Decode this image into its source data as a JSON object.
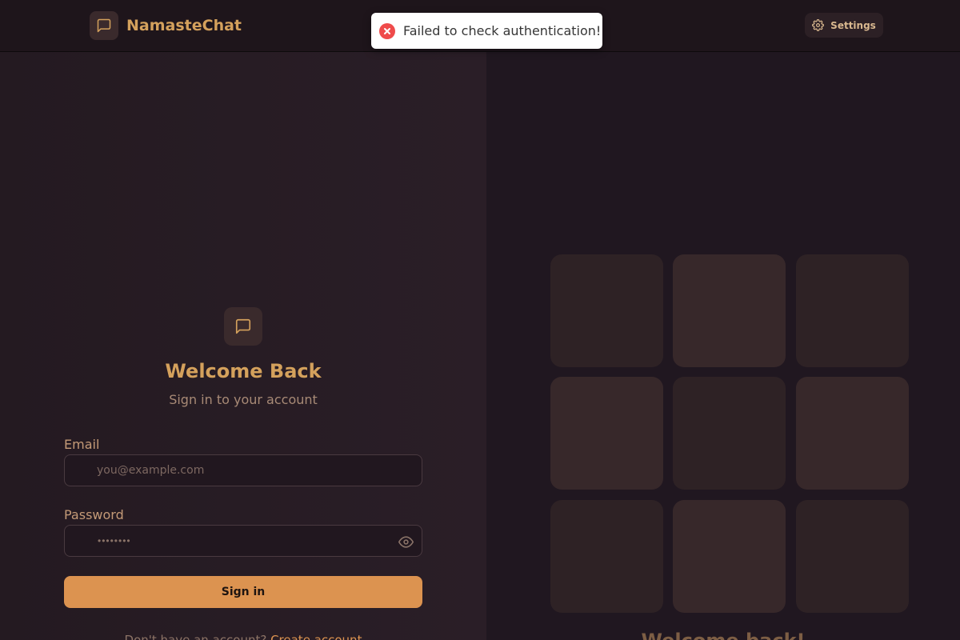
{
  "header": {
    "brand_name": "NamasteChat",
    "brand_icon": "message-square-icon",
    "settings_label": "Settings",
    "settings_icon": "gear-icon"
  },
  "toast": {
    "message": "Failed to check authentication!",
    "icon": "error-circle-icon",
    "status_color": "#ef4b4b"
  },
  "login": {
    "logo_icon": "message-square-icon",
    "title": "Welcome Back",
    "subtitle": "Sign in to your account",
    "email_label": "Email",
    "email_placeholder": "you@example.com",
    "email_value": "",
    "password_label": "Password",
    "password_placeholder": "••••••••",
    "password_value": "",
    "password_toggle_icon": "eye-icon",
    "submit_label": "Sign in",
    "signup_prompt": "Don't have an account? ",
    "signup_link": "Create account"
  },
  "aside": {
    "tiles_count": 9,
    "title": "Welcome back!"
  },
  "colors": {
    "accent": "#dc9350",
    "brand_text": "#d4a15c",
    "background": "#21171f"
  }
}
